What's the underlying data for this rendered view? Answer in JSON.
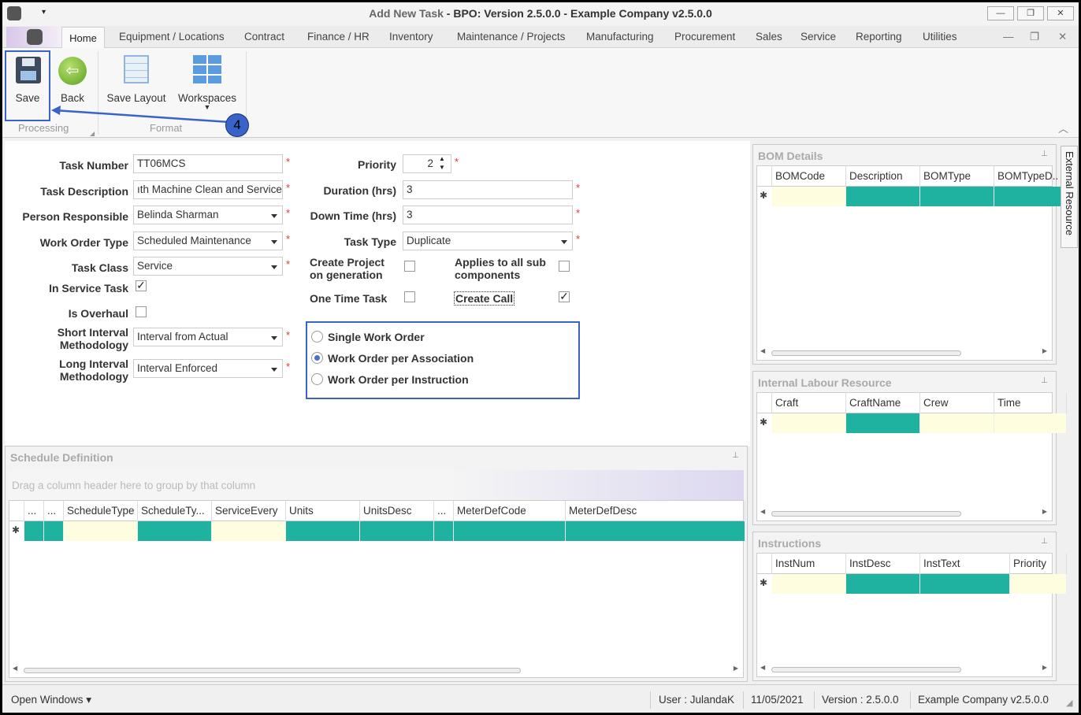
{
  "window": {
    "title_prefix": "Add New Task",
    "title_suffix": " - BPO: Version 2.5.0.0 - Example Company v2.5.0.0",
    "minimize": "—",
    "restore": "❐",
    "close": "✕"
  },
  "tabs": [
    "Home",
    "Equipment / Locations",
    "Contract",
    "Finance / HR",
    "Inventory",
    "Maintenance / Projects",
    "Manufacturing",
    "Procurement",
    "Sales",
    "Service",
    "Reporting",
    "Utilities"
  ],
  "ribbon": {
    "save": "Save",
    "back": "Back",
    "save_layout": "Save Layout",
    "workspaces": "Workspaces",
    "group_processing": "Processing",
    "group_format": "Format",
    "callout": "4",
    "accent": "#3a63c9"
  },
  "form": {
    "task_number": {
      "label": "Task Number",
      "value": "TT06MCS"
    },
    "task_description": {
      "label": "Task Description",
      "value": "ıth Machine Clean and Service"
    },
    "person_responsible": {
      "label": "Person Responsible",
      "value": "Belinda Sharman"
    },
    "work_order_type": {
      "label": "Work Order Type",
      "value": "Scheduled Maintenance"
    },
    "task_class": {
      "label": "Task Class",
      "value": "Service"
    },
    "in_service_task": {
      "label": "In Service Task",
      "checked": true
    },
    "is_overhaul": {
      "label": "Is Overhaul",
      "checked": false
    },
    "short_interval": {
      "label1": "Short Interval",
      "label2": "Methodology",
      "value": "Interval from Actual"
    },
    "long_interval": {
      "label1": "Long Interval",
      "label2": "Methodology",
      "value": "Interval Enforced"
    },
    "priority": {
      "label": "Priority",
      "value": "2"
    },
    "duration": {
      "label": "Duration (hrs)",
      "value": "3"
    },
    "down_time": {
      "label": "Down Time (hrs)",
      "value": "3"
    },
    "task_type": {
      "label": "Task Type",
      "value": "Duplicate"
    },
    "create_project": {
      "label1": "Create Project",
      "label2": "on generation",
      "checked": false
    },
    "applies_sub": {
      "label1": "Applies to all sub",
      "label2": "components",
      "checked": false
    },
    "one_time_task": {
      "label": "One Time Task",
      "checked": false
    },
    "create_call": {
      "label": "Create Call",
      "checked": true
    },
    "work_order_options": [
      {
        "label": "Single Work Order",
        "selected": false
      },
      {
        "label": "Work Order per Association",
        "selected": true
      },
      {
        "label": "Work Order per Instruction",
        "selected": false
      }
    ],
    "required_mark": "*"
  },
  "schedule": {
    "title": "Schedule Definition",
    "group_hint": "Drag a column header here to group by that column",
    "columns": [
      "...",
      "...",
      "ScheduleType",
      "ScheduleTy...",
      "ServiceEvery",
      "Units",
      "UnitsDesc",
      "...",
      "MeterDefCode",
      "MeterDefDesc"
    ],
    "new_row_fill": [
      "#20b2a0",
      "#20b2a0",
      "#fffde0",
      "#20b2a0",
      "#fffde0",
      "#20b2a0",
      "#20b2a0",
      "#20b2a0",
      "#20b2a0",
      "#20b2a0"
    ]
  },
  "bom": {
    "title": "BOM Details",
    "columns": [
      "BOMCode",
      "Description",
      "BOMType",
      "BOMTypeD.."
    ],
    "new_row_fill": [
      "#fffde0",
      "#20b2a0",
      "#20b2a0",
      "#20b2a0"
    ]
  },
  "labour": {
    "title": "Internal Labour Resource",
    "columns": [
      "Craft",
      "CraftName",
      "Crew",
      "Time"
    ],
    "new_row_fill": [
      "#fffde0",
      "#20b2a0",
      "#fffde0",
      "#fffde0"
    ]
  },
  "instructions": {
    "title": "Instructions",
    "columns": [
      "InstNum",
      "InstDesc",
      "InstText",
      "Priority"
    ],
    "new_row_fill": [
      "#fffde0",
      "#20b2a0",
      "#20b2a0",
      "#fffde0"
    ]
  },
  "side_tab": "External Resource",
  "new_row_marker": "✱",
  "status": {
    "open_windows": "Open Windows ▾",
    "user": "User : JulandaK",
    "date": "11/05/2021",
    "version": "Version : 2.5.0.0",
    "company": "Example Company v2.5.0.0"
  }
}
